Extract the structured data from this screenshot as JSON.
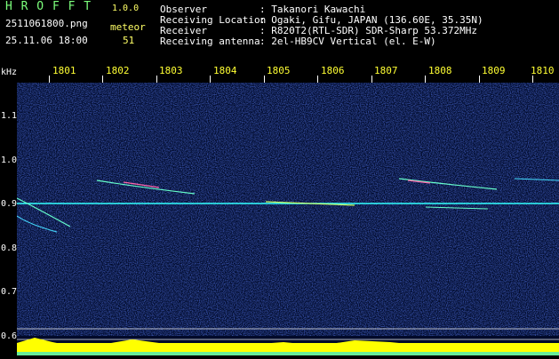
{
  "header": {
    "brand": "H R O F F T",
    "version": "1.0.0",
    "filename": "2511061800.png",
    "datetime": "25.11.06 18:00",
    "meteor_label": "meteor",
    "meteor_count": "51",
    "rows": [
      {
        "label": "Observer",
        "value": ": Takanori Kawachi"
      },
      {
        "label": "Receiving Location",
        "value": ": Ogaki, Gifu, JAPAN (136.60E, 35.35N)"
      },
      {
        "label": "Receiver",
        "value": ": R820T2(RTL-SDR) SDR-Sharp 53.372MHz"
      },
      {
        "label": "Receiving antenna",
        "value": ": 2el-HB9CV Vertical (el. E-W)"
      }
    ]
  },
  "axes": {
    "y_unit": "kHz",
    "x_ticks": [
      "1801",
      "1802",
      "1803",
      "1804",
      "1805",
      "1806",
      "1807",
      "1808",
      "1809",
      "1810"
    ],
    "y_ticks": [
      "1.1",
      "1.0",
      "0.9",
      "0.8",
      "0.7",
      "0.6"
    ]
  },
  "colors": {
    "background": "#000a2a",
    "carrier": "#33ffff",
    "noise_floor": "#ffff00",
    "signal_trace": "#66ffcc"
  }
}
